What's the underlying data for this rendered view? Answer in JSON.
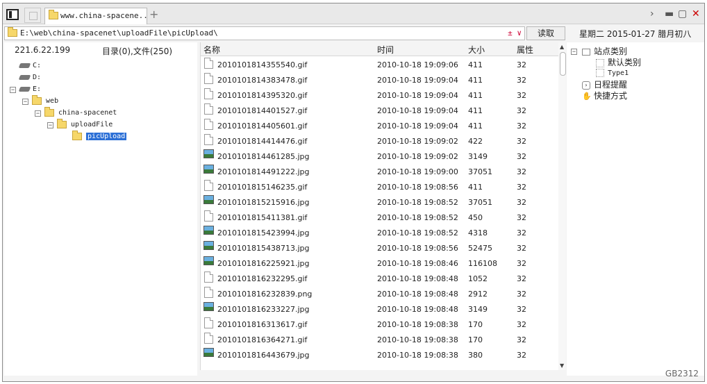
{
  "tab": {
    "title": "www.china-spacene..."
  },
  "address": {
    "path": "E:\\web\\china-spacenet\\uploadFile\\picUpload\\",
    "tools": "± ∨"
  },
  "read_button": "读取",
  "datebar": {
    "text": "星期二 2015-01-27 腊月初八"
  },
  "left": {
    "ip": "221.6.22.199",
    "dircount": "目录(0),文件(250)",
    "tree": [
      {
        "label": "C:"
      },
      {
        "label": "D:"
      },
      {
        "label": "E:"
      },
      {
        "label": "web"
      },
      {
        "label": "china-spacenet"
      },
      {
        "label": "uploadFile"
      },
      {
        "label": "picUpload"
      }
    ]
  },
  "files": {
    "columns": [
      "名称",
      "时间",
      "大小",
      "属性"
    ],
    "rows": [
      {
        "name": "2010101814355540.gif",
        "time": "2010-10-18 19:09:06",
        "size": "411",
        "attr": "32",
        "type": "gif"
      },
      {
        "name": "2010101814383478.gif",
        "time": "2010-10-18 19:09:04",
        "size": "411",
        "attr": "32",
        "type": "gif"
      },
      {
        "name": "2010101814395320.gif",
        "time": "2010-10-18 19:09:04",
        "size": "411",
        "attr": "32",
        "type": "gif"
      },
      {
        "name": "2010101814401527.gif",
        "time": "2010-10-18 19:09:04",
        "size": "411",
        "attr": "32",
        "type": "gif"
      },
      {
        "name": "2010101814405601.gif",
        "time": "2010-10-18 19:09:04",
        "size": "411",
        "attr": "32",
        "type": "gif"
      },
      {
        "name": "2010101814414476.gif",
        "time": "2010-10-18 19:09:02",
        "size": "422",
        "attr": "32",
        "type": "gif"
      },
      {
        "name": "2010101814461285.jpg",
        "time": "2010-10-18 19:09:02",
        "size": "3149",
        "attr": "32",
        "type": "jpg"
      },
      {
        "name": "2010101814491222.jpg",
        "time": "2010-10-18 19:09:00",
        "size": "37051",
        "attr": "32",
        "type": "jpg"
      },
      {
        "name": "2010101815146235.gif",
        "time": "2010-10-18 19:08:56",
        "size": "411",
        "attr": "32",
        "type": "gif"
      },
      {
        "name": "2010101815215916.jpg",
        "time": "2010-10-18 19:08:52",
        "size": "37051",
        "attr": "32",
        "type": "jpg"
      },
      {
        "name": "2010101815411381.gif",
        "time": "2010-10-18 19:08:52",
        "size": "450",
        "attr": "32",
        "type": "gif"
      },
      {
        "name": "2010101815423994.jpg",
        "time": "2010-10-18 19:08:52",
        "size": "4318",
        "attr": "32",
        "type": "jpg"
      },
      {
        "name": "2010101815438713.jpg",
        "time": "2010-10-18 19:08:56",
        "size": "52475",
        "attr": "32",
        "type": "jpg"
      },
      {
        "name": "2010101816225921.jpg",
        "time": "2010-10-18 19:08:46",
        "size": "116108",
        "attr": "32",
        "type": "jpg"
      },
      {
        "name": "2010101816232295.gif",
        "time": "2010-10-18 19:08:48",
        "size": "1052",
        "attr": "32",
        "type": "gif"
      },
      {
        "name": "2010101816232839.png",
        "time": "2010-10-18 19:08:48",
        "size": "2912",
        "attr": "32",
        "type": "gif"
      },
      {
        "name": "2010101816233227.jpg",
        "time": "2010-10-18 19:08:48",
        "size": "3149",
        "attr": "32",
        "type": "jpg"
      },
      {
        "name": "2010101816313617.gif",
        "time": "2010-10-18 19:08:38",
        "size": "170",
        "attr": "32",
        "type": "gif"
      },
      {
        "name": "2010101816364271.gif",
        "time": "2010-10-18 19:08:38",
        "size": "170",
        "attr": "32",
        "type": "gif"
      },
      {
        "name": "2010101816443679.jpg",
        "time": "2010-10-18 19:08:38",
        "size": "380",
        "attr": "32",
        "type": "jpg"
      }
    ]
  },
  "right": {
    "items": [
      {
        "label": "站点类别"
      },
      {
        "label": "默认类别"
      },
      {
        "label": "Type1"
      },
      {
        "label": "日程提醒"
      },
      {
        "label": "快捷方式"
      }
    ]
  },
  "footer": {
    "text": "GB2312"
  },
  "colors": {
    "selection": "#2b6fd6",
    "close": "#cc0000"
  }
}
